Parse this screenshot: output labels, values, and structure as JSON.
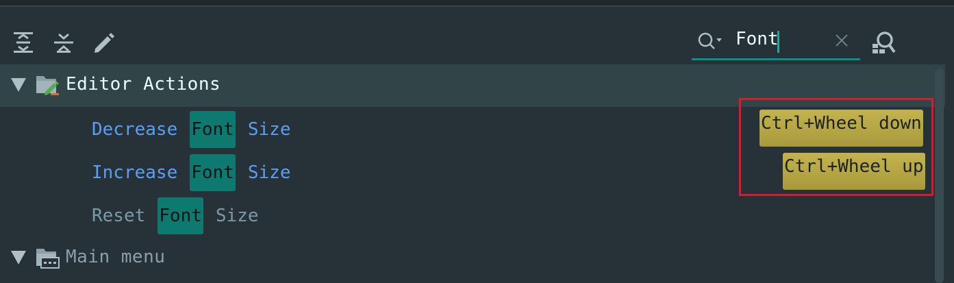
{
  "toolbar": {
    "expand_all_icon": "expand-all-icon",
    "collapse_all_icon": "collapse-all-icon",
    "edit_icon": "pencil-icon"
  },
  "search": {
    "value": "Font",
    "accent": "#009688"
  },
  "tree": {
    "groups": [
      {
        "label": "Editor Actions",
        "expanded": true,
        "selected": true,
        "actions": [
          {
            "pre": "Decrease",
            "match": "Font",
            "post": "Size",
            "shortcut": "Ctrl+Wheel down",
            "enabled": true
          },
          {
            "pre": "Increase",
            "match": "Font",
            "post": "Size",
            "shortcut": "Ctrl+Wheel up",
            "enabled": true
          },
          {
            "pre": "Reset",
            "match": "Font",
            "post": "Size",
            "shortcut": "",
            "enabled": false
          }
        ]
      },
      {
        "label": "Main menu",
        "expanded": true,
        "selected": false
      }
    ]
  },
  "colors": {
    "background": "#263238",
    "match_highlight": "#0e7a6f",
    "shortcut_bg": "#b5a642",
    "link_text": "#5c9ef6",
    "annotation": "#e0182e"
  }
}
